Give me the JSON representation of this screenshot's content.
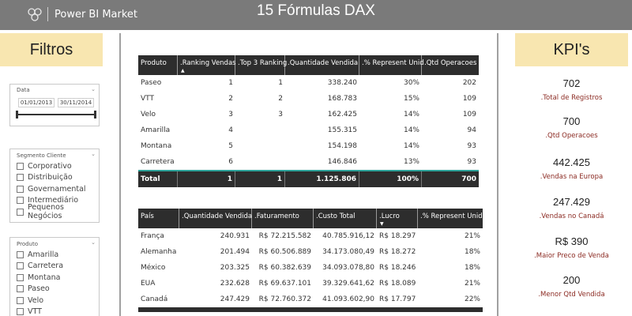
{
  "header": {
    "brand": "Power BI Market",
    "title": "15 Fórmulas DAX"
  },
  "filters": {
    "title": "Filtros",
    "date_slicer": {
      "label": "Data",
      "start": "01/01/2013",
      "end": "30/11/2014"
    },
    "segment_slicer": {
      "label": "Segmento Cliente",
      "items": [
        "Corporativo",
        "Distribuição",
        "Governamental",
        "Intermediário",
        "Pequenos Negócios"
      ]
    },
    "product_slicer": {
      "label": "Produto",
      "items": [
        "Amarilla",
        "Carretera",
        "Montana",
        "Paseo",
        "Velo",
        "VTT"
      ]
    }
  },
  "product_table": {
    "columns": [
      "Produto",
      ".Ranking Vendas",
      ".Top 3 Ranking",
      ".Quantidade Vendida",
      ".% Represent Unid",
      ".Qtd Operacoes"
    ],
    "rows": [
      [
        "Paseo",
        "1",
        "1",
        "338.240",
        "30%",
        "202"
      ],
      [
        "VTT",
        "2",
        "2",
        "168.783",
        "15%",
        "109"
      ],
      [
        "Velo",
        "3",
        "3",
        "162.425",
        "14%",
        "109"
      ],
      [
        "Amarilla",
        "4",
        "",
        "155.315",
        "14%",
        "94"
      ],
      [
        "Montana",
        "5",
        "",
        "154.198",
        "14%",
        "93"
      ],
      [
        "Carretera",
        "6",
        "",
        "146.846",
        "13%",
        "93"
      ]
    ],
    "total": [
      "Total",
      "1",
      "1",
      "1.125.806",
      "100%",
      "700"
    ]
  },
  "country_table": {
    "columns": [
      "País",
      ".Quantidade Vendida",
      ".Faturamento",
      ".Custo Total",
      ".Lucro",
      ".% Represent Unid"
    ],
    "rows": [
      [
        "França",
        "240.931",
        "R$ 72.215.582",
        "40.785.916,12",
        "R$ 18.297",
        "21%"
      ],
      [
        "Alemanha",
        "201.494",
        "R$ 60.506.889",
        "34.173.080,49",
        "R$ 18.272",
        "18%"
      ],
      [
        "México",
        "203.325",
        "R$ 60.382.639",
        "34.093.078,80",
        "R$ 18.246",
        "18%"
      ],
      [
        "EUA",
        "232.628",
        "R$ 69.637.101",
        "39.329.641,62",
        "R$ 18.089",
        "21%"
      ],
      [
        "Canadá",
        "247.429",
        "R$ 72.760.372",
        "41.093.602,90",
        "R$ 17.797",
        "22%"
      ]
    ]
  },
  "kpis": {
    "title": "KPI's",
    "items": [
      {
        "value": "702",
        "label": ".Total de Registros"
      },
      {
        "value": "700",
        "label": ".Qtd Operacoes"
      },
      {
        "value": "442.425",
        "label": ".Vendas na Europa"
      },
      {
        "value": "247.429",
        "label": ".Vendas no Canadá"
      },
      {
        "value": "R$ 390",
        "label": ".Maior Preco de Venda"
      },
      {
        "value": "200",
        "label": ".Menor Qtd Vendida"
      }
    ]
  },
  "colors": {
    "header_bg": "#7a7a7a",
    "panel_title_bg": "#f8e6b0",
    "table_header_bg": "#2d2d2d",
    "kpi_label": "#8b2a22",
    "total_border": "#2ea39a"
  }
}
